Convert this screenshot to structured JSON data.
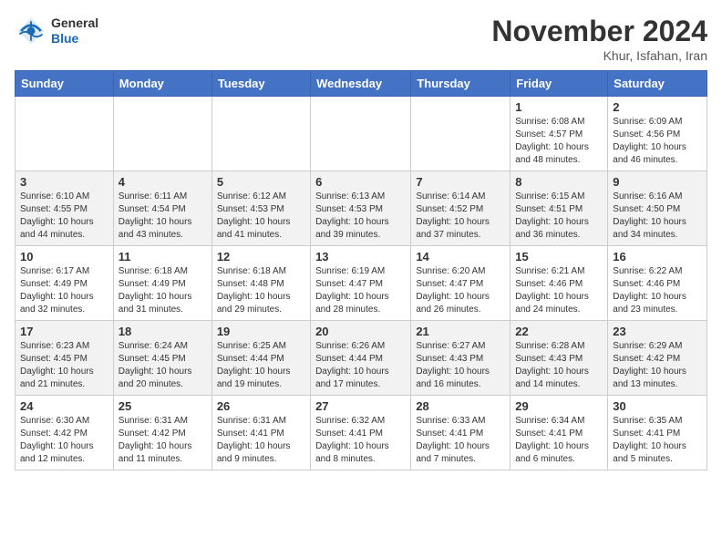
{
  "header": {
    "logo_line1": "General",
    "logo_line2": "Blue",
    "month": "November 2024",
    "location": "Khur, Isfahan, Iran"
  },
  "weekdays": [
    "Sunday",
    "Monday",
    "Tuesday",
    "Wednesday",
    "Thursday",
    "Friday",
    "Saturday"
  ],
  "weeks": [
    [
      {
        "day": "",
        "info": ""
      },
      {
        "day": "",
        "info": ""
      },
      {
        "day": "",
        "info": ""
      },
      {
        "day": "",
        "info": ""
      },
      {
        "day": "",
        "info": ""
      },
      {
        "day": "1",
        "info": "Sunrise: 6:08 AM\nSunset: 4:57 PM\nDaylight: 10 hours\nand 48 minutes."
      },
      {
        "day": "2",
        "info": "Sunrise: 6:09 AM\nSunset: 4:56 PM\nDaylight: 10 hours\nand 46 minutes."
      }
    ],
    [
      {
        "day": "3",
        "info": "Sunrise: 6:10 AM\nSunset: 4:55 PM\nDaylight: 10 hours\nand 44 minutes."
      },
      {
        "day": "4",
        "info": "Sunrise: 6:11 AM\nSunset: 4:54 PM\nDaylight: 10 hours\nand 43 minutes."
      },
      {
        "day": "5",
        "info": "Sunrise: 6:12 AM\nSunset: 4:53 PM\nDaylight: 10 hours\nand 41 minutes."
      },
      {
        "day": "6",
        "info": "Sunrise: 6:13 AM\nSunset: 4:53 PM\nDaylight: 10 hours\nand 39 minutes."
      },
      {
        "day": "7",
        "info": "Sunrise: 6:14 AM\nSunset: 4:52 PM\nDaylight: 10 hours\nand 37 minutes."
      },
      {
        "day": "8",
        "info": "Sunrise: 6:15 AM\nSunset: 4:51 PM\nDaylight: 10 hours\nand 36 minutes."
      },
      {
        "day": "9",
        "info": "Sunrise: 6:16 AM\nSunset: 4:50 PM\nDaylight: 10 hours\nand 34 minutes."
      }
    ],
    [
      {
        "day": "10",
        "info": "Sunrise: 6:17 AM\nSunset: 4:49 PM\nDaylight: 10 hours\nand 32 minutes."
      },
      {
        "day": "11",
        "info": "Sunrise: 6:18 AM\nSunset: 4:49 PM\nDaylight: 10 hours\nand 31 minutes."
      },
      {
        "day": "12",
        "info": "Sunrise: 6:18 AM\nSunset: 4:48 PM\nDaylight: 10 hours\nand 29 minutes."
      },
      {
        "day": "13",
        "info": "Sunrise: 6:19 AM\nSunset: 4:47 PM\nDaylight: 10 hours\nand 28 minutes."
      },
      {
        "day": "14",
        "info": "Sunrise: 6:20 AM\nSunset: 4:47 PM\nDaylight: 10 hours\nand 26 minutes."
      },
      {
        "day": "15",
        "info": "Sunrise: 6:21 AM\nSunset: 4:46 PM\nDaylight: 10 hours\nand 24 minutes."
      },
      {
        "day": "16",
        "info": "Sunrise: 6:22 AM\nSunset: 4:46 PM\nDaylight: 10 hours\nand 23 minutes."
      }
    ],
    [
      {
        "day": "17",
        "info": "Sunrise: 6:23 AM\nSunset: 4:45 PM\nDaylight: 10 hours\nand 21 minutes."
      },
      {
        "day": "18",
        "info": "Sunrise: 6:24 AM\nSunset: 4:45 PM\nDaylight: 10 hours\nand 20 minutes."
      },
      {
        "day": "19",
        "info": "Sunrise: 6:25 AM\nSunset: 4:44 PM\nDaylight: 10 hours\nand 19 minutes."
      },
      {
        "day": "20",
        "info": "Sunrise: 6:26 AM\nSunset: 4:44 PM\nDaylight: 10 hours\nand 17 minutes."
      },
      {
        "day": "21",
        "info": "Sunrise: 6:27 AM\nSunset: 4:43 PM\nDaylight: 10 hours\nand 16 minutes."
      },
      {
        "day": "22",
        "info": "Sunrise: 6:28 AM\nSunset: 4:43 PM\nDaylight: 10 hours\nand 14 minutes."
      },
      {
        "day": "23",
        "info": "Sunrise: 6:29 AM\nSunset: 4:42 PM\nDaylight: 10 hours\nand 13 minutes."
      }
    ],
    [
      {
        "day": "24",
        "info": "Sunrise: 6:30 AM\nSunset: 4:42 PM\nDaylight: 10 hours\nand 12 minutes."
      },
      {
        "day": "25",
        "info": "Sunrise: 6:31 AM\nSunset: 4:42 PM\nDaylight: 10 hours\nand 11 minutes."
      },
      {
        "day": "26",
        "info": "Sunrise: 6:31 AM\nSunset: 4:41 PM\nDaylight: 10 hours\nand 9 minutes."
      },
      {
        "day": "27",
        "info": "Sunrise: 6:32 AM\nSunset: 4:41 PM\nDaylight: 10 hours\nand 8 minutes."
      },
      {
        "day": "28",
        "info": "Sunrise: 6:33 AM\nSunset: 4:41 PM\nDaylight: 10 hours\nand 7 minutes."
      },
      {
        "day": "29",
        "info": "Sunrise: 6:34 AM\nSunset: 4:41 PM\nDaylight: 10 hours\nand 6 minutes."
      },
      {
        "day": "30",
        "info": "Sunrise: 6:35 AM\nSunset: 4:41 PM\nDaylight: 10 hours\nand 5 minutes."
      }
    ]
  ]
}
